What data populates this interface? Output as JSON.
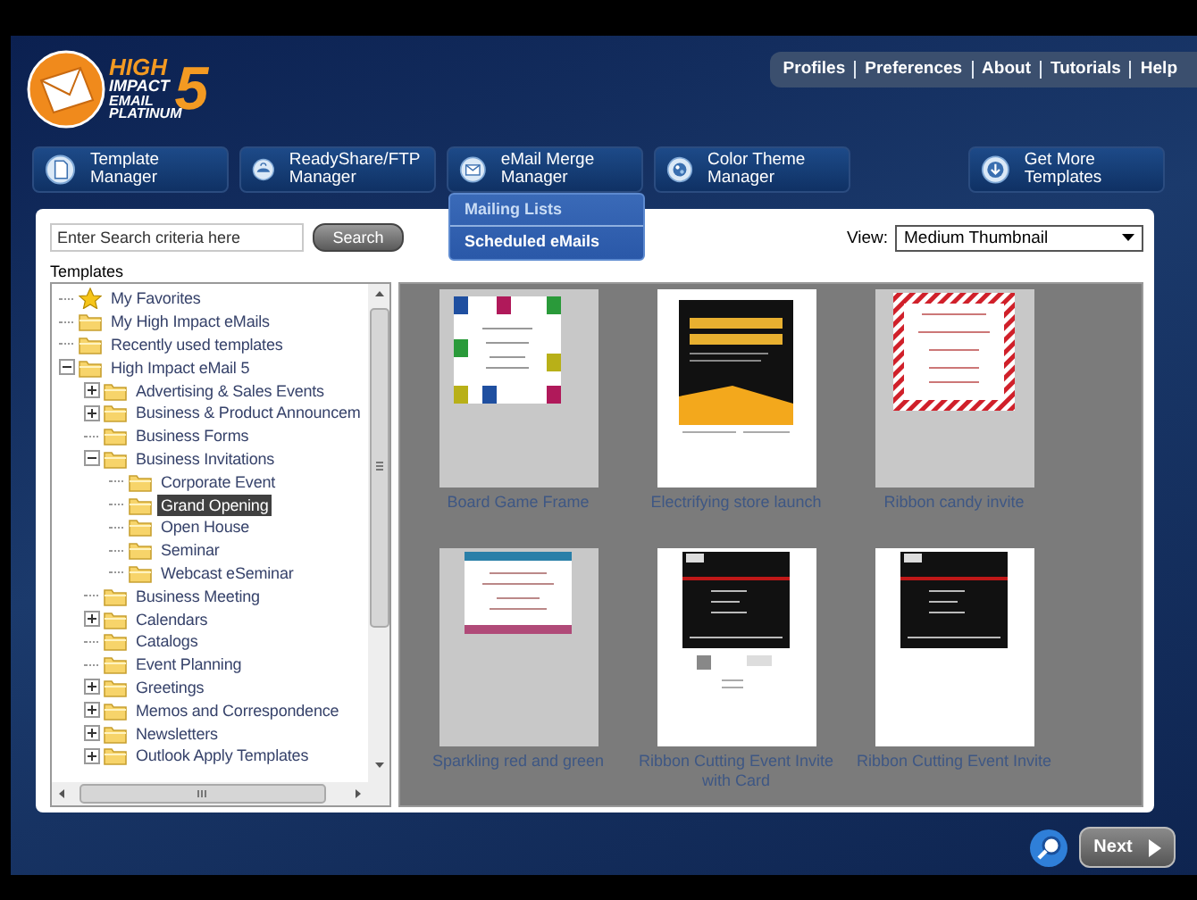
{
  "logo": {
    "lines": [
      "HIGH",
      "IMPACT",
      "EMAIL",
      "PLATINUM"
    ],
    "numeral": "5"
  },
  "top_links": [
    "Profiles",
    "Preferences",
    "About",
    "Tutorials",
    "Help"
  ],
  "nav_buttons": [
    {
      "label": "Template Manager",
      "kind": "page"
    },
    {
      "label": "ReadyShare/FTP Manager",
      "kind": "share"
    },
    {
      "label": "eMail Merge Manager",
      "kind": "mail"
    },
    {
      "label": "Color Theme Manager",
      "kind": "palette"
    },
    {
      "label": "Get More Templates",
      "kind": "download"
    }
  ],
  "merge_menu": [
    "Mailing Lists",
    "Scheduled eMails"
  ],
  "search": {
    "placeholder": "Enter Search criteria here",
    "button": "Search"
  },
  "view": {
    "label": "View:",
    "value": "Medium Thumbnail"
  },
  "tree_title": "Templates",
  "tree": [
    {
      "label": "My Favorites",
      "kind": "star",
      "selected": false
    },
    {
      "label": "My High Impact eMails",
      "kind": "folder",
      "selected": false
    },
    {
      "label": "Recently used templates",
      "kind": "folder",
      "selected": false
    },
    {
      "label": "High Impact eMail 5",
      "kind": "folder",
      "selected": false,
      "expanded": true,
      "children": [
        {
          "label": "Advertising & Sales Events",
          "kind": "folder",
          "selected": false,
          "expanded": false
        },
        {
          "label": "Business & Product Announcem",
          "kind": "folder",
          "selected": false,
          "expanded": false
        },
        {
          "label": "Business Forms",
          "kind": "folder",
          "selected": false
        },
        {
          "label": "Business Invitations",
          "kind": "folder",
          "selected": false,
          "expanded": true,
          "children": [
            {
              "label": "Corporate Event",
              "kind": "folder",
              "selected": false
            },
            {
              "label": "Grand Opening",
              "kind": "folder",
              "selected": true
            },
            {
              "label": "Open House",
              "kind": "folder",
              "selected": false
            },
            {
              "label": "Seminar",
              "kind": "folder",
              "selected": false
            },
            {
              "label": "Webcast eSeminar",
              "kind": "folder",
              "selected": false
            }
          ]
        },
        {
          "label": "Business Meeting",
          "kind": "folder",
          "selected": false
        },
        {
          "label": "Calendars",
          "kind": "folder",
          "selected": false,
          "expanded": false
        },
        {
          "label": "Catalogs",
          "kind": "folder",
          "selected": false
        },
        {
          "label": "Event Planning",
          "kind": "folder",
          "selected": false
        },
        {
          "label": "Greetings",
          "kind": "folder",
          "selected": false,
          "expanded": false
        },
        {
          "label": "Memos and Correspondence",
          "kind": "folder",
          "selected": false,
          "expanded": false
        },
        {
          "label": "Newsletters",
          "kind": "folder",
          "selected": false,
          "expanded": false
        },
        {
          "label": "Outlook Apply Templates",
          "kind": "folder",
          "selected": false,
          "expanded": false
        }
      ]
    }
  ],
  "thumbnails": [
    {
      "label": "Board Game Frame",
      "kind": "board"
    },
    {
      "label": "Electrifying store launch",
      "kind": "poster"
    },
    {
      "label": "Ribbon candy invite",
      "kind": "stripes"
    },
    {
      "label": "Sparkling red and green",
      "kind": "banner"
    },
    {
      "label": "Ribbon Cutting Event Invite with Card",
      "kind": "flyercard"
    },
    {
      "label": "Ribbon Cutting Event Invite",
      "kind": "flyer"
    }
  ],
  "next_button": "Next"
}
